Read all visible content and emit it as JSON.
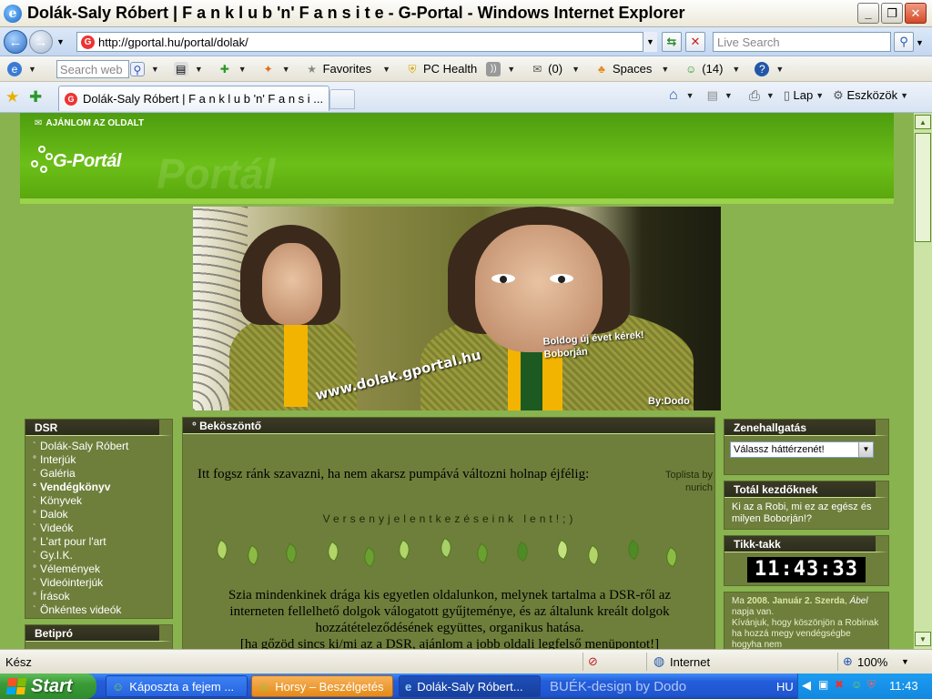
{
  "window": {
    "title": "Dolák-Saly Róbert | F a n k l u b 'n' F a n s i t e - G-Portal - Windows Internet Explorer"
  },
  "address": {
    "url": "http://gportal.hu/portal/dolak/",
    "live_search_placeholder": "Live Search"
  },
  "toolbar": {
    "web_search_placeholder": "Search web",
    "favorites": "Favorites",
    "pc_health": "PC Health",
    "mail_count": "(0)",
    "spaces": "Spaces",
    "messenger_count": "(14)"
  },
  "tab": {
    "title": "Dolák-Saly Róbert | F a n k l u b 'n' F a n s i ..."
  },
  "commandbar": {
    "page": "Lap",
    "tools": "Eszközök"
  },
  "page": {
    "ajanlom": "AJÁNLOM AZ OLDALT",
    "logo_text": "G-Portál",
    "logo_ghost": "Portál",
    "banner": {
      "url_text": "www.dolak.gportal.hu",
      "greeting_line1": "Boldog új évet kérek!",
      "greeting_line2": "Boborján",
      "credit": "By:Dodo"
    },
    "dsr": {
      "title": "DSR",
      "items": [
        {
          "label": "Dolák-Saly Róbert",
          "bullet": "`",
          "bold": false
        },
        {
          "label": "Interjúk",
          "bullet": "°",
          "bold": false
        },
        {
          "label": "Galéria",
          "bullet": "`",
          "bold": false
        },
        {
          "label": "Vendégkönyv",
          "bullet": "°",
          "bold": true
        },
        {
          "label": "Könyvek",
          "bullet": "`",
          "bold": false
        },
        {
          "label": "Dalok",
          "bullet": "°",
          "bold": false
        },
        {
          "label": "Videók",
          "bullet": "`",
          "bold": false
        },
        {
          "label": "L'art pour l'art",
          "bullet": "°",
          "bold": false
        },
        {
          "label": "Gy.I.K.",
          "bullet": "`",
          "bold": false
        },
        {
          "label": "Vélemények",
          "bullet": "°",
          "bold": false
        },
        {
          "label": "Videóinterjúk",
          "bullet": "`",
          "bold": false
        },
        {
          "label": "Írások",
          "bullet": "°",
          "bold": false
        },
        {
          "label": "Önkéntes videók",
          "bullet": "`",
          "bold": false
        }
      ]
    },
    "betipro": {
      "title": "Betipró"
    },
    "welcome_box": {
      "title": "° Beköszöntő",
      "invite": "Itt fogsz ránk szavazni, ha nem akarsz pumpává változni holnap éjfélig:",
      "toplista": "Toplista by nurich",
      "verseny": "Versenyjelentkezéseink lent!;)",
      "text_line1": "Szia mindenkinek drága kis egyetlen oldalunkon, melynek tartalma a DSR-ről az",
      "text_line2": "interneten fellelhető dolgok válogatott gyűjteménye, és az általunk kreált dolgok",
      "text_line3": "hozzátételeződésének együttes, organikus hatása.",
      "text_line4": "[ha gőzöd sincs ki/mi az a DSR, ajánlom a jobb oldali legfelső menüpontot!]"
    },
    "zene": {
      "title": "Zenehallgatás",
      "select_value": "Válassz háttérzenét!"
    },
    "total": {
      "title": "Totál kezdőknek",
      "text": "Ki az a Robi, mi ez az egész és milyen Boborján!?"
    },
    "tikk": {
      "title": "Tikk-takk",
      "clock": "11:43:33"
    },
    "nameday": {
      "prefix": "Ma",
      "date": "2008. Január 2. Szerda",
      "sep": ",",
      "name": "Ábel",
      "suffix": "napja van.",
      "text": "Kívánjuk, hogy köszönjön a Robinak ha hozzá megy vendégségbe hogyha nem"
    }
  },
  "status": {
    "left": "Kész",
    "zone": "Internet",
    "zoom": "100%"
  },
  "taskbar": {
    "start": "Start",
    "tasks": [
      "Káposzta a fejem ...",
      "Horsy – Beszélgetés",
      "Dolák-Saly Róbert..."
    ],
    "desktop_text": "BUÉK-design by Dodo",
    "lang": "HU",
    "time": "11:43"
  }
}
